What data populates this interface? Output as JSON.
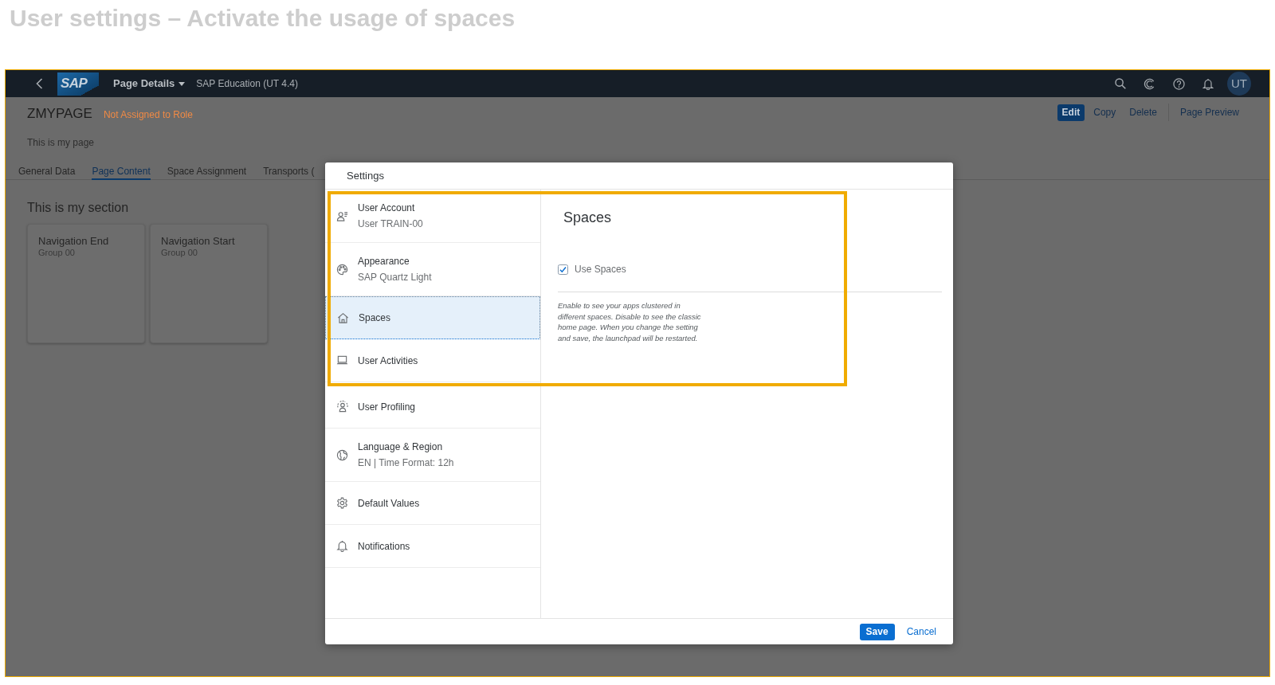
{
  "slide_title": "User settings – Activate the usage of spaces",
  "shell_bar": {
    "logo": "SAP",
    "title": "Page Details",
    "subtitle": "SAP Education (UT 4.4)",
    "avatar": "UT"
  },
  "page_header": {
    "title": "ZMYPAGE",
    "status": "Not Assigned to Role",
    "description": "This is my page",
    "action_groups": [
      [
        {
          "label": "Edit",
          "kind": "emphasized"
        },
        {
          "label": "Copy",
          "kind": "transparent"
        },
        {
          "label": "Delete",
          "kind": "transparent"
        }
      ],
      [
        {
          "label": "Page Preview",
          "kind": "transparent"
        }
      ]
    ]
  },
  "tabs": [
    {
      "label": "General Data",
      "selected": false
    },
    {
      "label": "Page Content",
      "selected": true
    },
    {
      "label": "Space Assignment",
      "selected": false
    },
    {
      "label": "Transports (",
      "selected": false
    }
  ],
  "section": {
    "title": "This is my section",
    "tiles": [
      {
        "title": "Navigation End",
        "subtitle": "Group 00"
      },
      {
        "title": "Navigation Start",
        "subtitle": "Group 00"
      }
    ]
  },
  "dialog": {
    "title": "Settings",
    "items": [
      {
        "title": "User Account",
        "subtitle": "User TRAIN-00",
        "selected": false
      },
      {
        "title": "Appearance",
        "subtitle": "SAP Quartz Light",
        "selected": false
      },
      {
        "title": "Spaces",
        "selected": true
      },
      {
        "title": "User Activities",
        "selected": false
      },
      {
        "title": "User Profiling",
        "selected": false
      },
      {
        "title": "Language & Region",
        "subtitle": "EN | Time Format: 12h",
        "selected": false
      },
      {
        "title": "Default Values",
        "selected": false
      },
      {
        "title": "Notifications",
        "selected": false
      }
    ],
    "detail": {
      "title": "Spaces",
      "option": {
        "label": "Use Spaces",
        "checked": true
      },
      "description": "Enable to see your apps clustered in different spaces. Disable to see the classic home page. When you change the setting and save, the launchpad will be restarted."
    },
    "buttons": [
      {
        "label": "Save",
        "kind": "emphasized"
      },
      {
        "label": "Cancel",
        "kind": "transparent"
      }
    ]
  }
}
